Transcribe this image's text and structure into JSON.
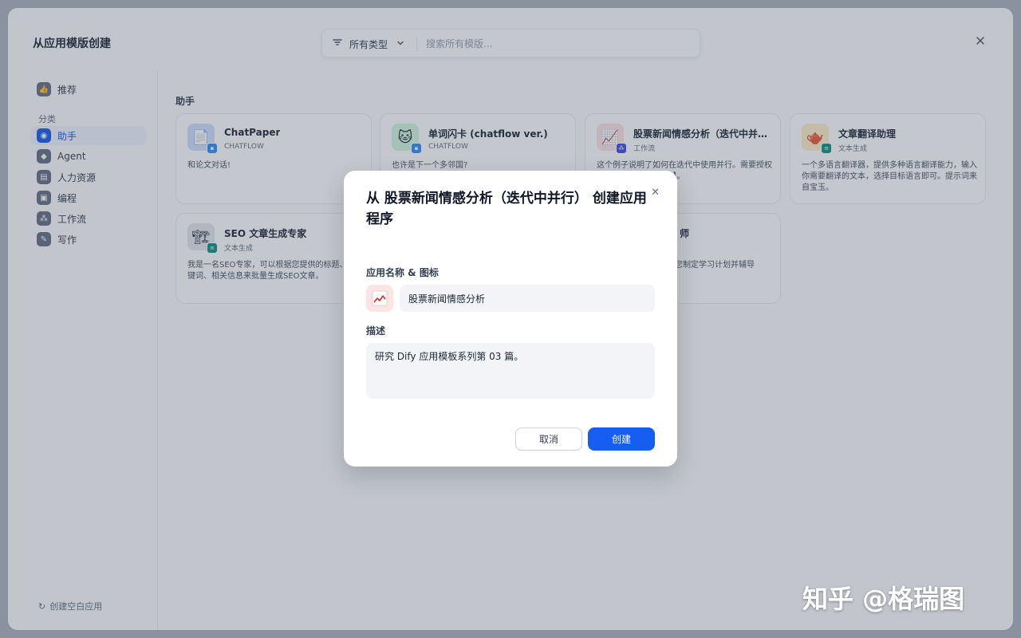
{
  "header": {
    "title": "从应用模版创建",
    "filter_label": "所有类型",
    "search_placeholder": "搜索所有模版..."
  },
  "sidebar": {
    "items": [
      {
        "label": "推荐",
        "icon": "thumbs-up-icon"
      },
      {
        "label": "助手",
        "icon": "assistant-icon"
      },
      {
        "label": "Agent",
        "icon": "agent-icon"
      },
      {
        "label": "人力资源",
        "icon": "hr-icon"
      },
      {
        "label": "编程",
        "icon": "code-icon"
      },
      {
        "label": "工作流",
        "icon": "workflow-icon"
      },
      {
        "label": "写作",
        "icon": "pen-icon"
      }
    ],
    "section_label": "分类",
    "create_blank": "创建空白应用"
  },
  "main": {
    "section_title": "助手",
    "cards": [
      {
        "name": "ChatPaper",
        "type": "CHATFLOW",
        "desc": "和论文对话!",
        "icon": "📄",
        "icon_bg": "#d1e0ff",
        "badge_color": "#2e90fa"
      },
      {
        "name": "单词闪卡 (chatflow ver.)",
        "type": "CHATFLOW",
        "desc": "也许是下一个多邻国?",
        "icon": "🐱",
        "icon_bg": "#d3f8df",
        "badge_color": "#2e90fa"
      },
      {
        "name": "股票新闻情感分析（迭代中并…",
        "type": "工作流",
        "desc": "这个例子说明了如何在迭代中使用并行。需要授权使用【Tavily Search】。",
        "icon": "📈",
        "icon_bg": "#fee4e2",
        "badge_color": "#444ce7"
      },
      {
        "name": "文章翻译助理",
        "type": "文本生成",
        "desc": "一个多语言翻译器，提供多种语言翻译能力，输入你需要翻译的文本，选择目标语言即可。提示词来自宝玉。",
        "icon": "🫖",
        "icon_bg": "#fef0c7",
        "badge_color": "#0e9384"
      },
      {
        "name": "SEO 文章生成专家",
        "type": "文本生成",
        "desc": "我是一名SEO专家，可以根据您提供的标题、关键词、相关信息来批量生成SEO文章。",
        "icon": "🏗",
        "icon_bg": "#e4e7ec",
        "badge_color": "#0e9384"
      },
      {
        "name": "师",
        "type": "",
        "desc": "您制定学习计划并辅导",
        "icon": "",
        "icon_bg": "#ffffff",
        "badge_color": "#ffffff"
      }
    ]
  },
  "dialog": {
    "title": "从 股票新闻情感分析（迭代中并行） 创建应用程序",
    "name_label": "应用名称 & 图标",
    "app_icon": "📈",
    "name_value": "股票新闻情感分析",
    "desc_label": "描述",
    "desc_value": "研究 Dify 应用模板系列第 03 篇。",
    "cancel_label": "取消",
    "create_label": "创建"
  },
  "watermark": "知乎 @格瑞图"
}
